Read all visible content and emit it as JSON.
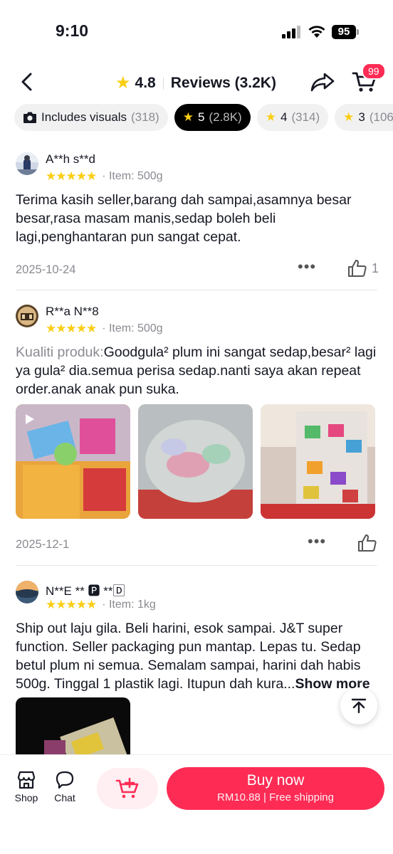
{
  "status_bar": {
    "time": "9:10",
    "battery": "95"
  },
  "header": {
    "rating": "4.8",
    "title": "Reviews (3.2K)",
    "cart_count": "99"
  },
  "filters": [
    {
      "label": "Includes visuals",
      "count": "(318)"
    },
    {
      "label": "5",
      "count": "(2.8K)"
    },
    {
      "label": "4",
      "count": "(314)"
    },
    {
      "label": "3",
      "count": "(106)"
    }
  ],
  "reviews": [
    {
      "user": "A**h s**d",
      "rating": 5,
      "item": "· Item: 500g",
      "text": "Terima kasih seller,barang dah sampai,asamnya besar besar,rasa masam manis,sedap boleh beli lagi,penghantaran pun sangat cepat.",
      "date": "2025-10-24",
      "likes": "1"
    },
    {
      "user": "R**a N**8",
      "rating": 5,
      "item": "· Item: 500g",
      "label": "Kualiti produk:",
      "text": "Goodgula² plum ini sangat sedap,besar² lagi ya gula² dia.semua perisa sedap.nanti saya akan repeat order.anak anak pun suka.",
      "date": "2025-12-1",
      "likes": ""
    },
    {
      "user": "N**E ** 🅿 **🄳",
      "rating": 5,
      "item": "· Item: 1kg",
      "text": "Ship out laju gila. Beli harini, esok sampai. J&T super function. Seller packaging pun mantap. Lepas tu. Sedap betul plum ni semua. Semalam sampai, harini dah habis 500g. Tinggal 1 plastik lagi. Itupun dah kura...",
      "more": "Show more"
    }
  ],
  "bottom": {
    "shop": "Shop",
    "chat": "Chat",
    "buy_now": "Buy now",
    "price": "RM10.88",
    "shipping": "Free shipping"
  },
  "colors": {
    "accent": "#FE2C55",
    "star": "#FACE15"
  }
}
